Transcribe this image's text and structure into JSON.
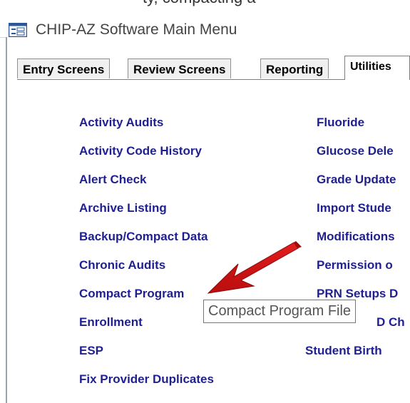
{
  "clipped_top_text": "ty, compacting a",
  "window": {
    "title": "CHIP-AZ Software Main Menu"
  },
  "tabs": [
    {
      "label": "Entry Screens",
      "active": false
    },
    {
      "label": "Review Screens",
      "active": false
    },
    {
      "label": "Reporting",
      "active": false
    },
    {
      "label": "Utilities",
      "active": true
    }
  ],
  "utilities": {
    "left_column": [
      "Activity Audits",
      "Activity Code History",
      "Alert Check",
      "Archive Listing",
      "Backup/Compact Data",
      "Chronic Audits",
      "Compact Program",
      "Enrollment",
      "ESP",
      "Fix Provider Duplicates"
    ],
    "right_column": [
      "Fluoride",
      "Glucose Dele",
      "Grade Update",
      "Import Stude",
      "Modifications",
      "Permission o",
      "PRN Setups D",
      "D Ch",
      "Student Birth"
    ]
  },
  "tooltip": {
    "text": "Compact Program File"
  },
  "colors": {
    "link": "#1f1f8f",
    "arrow": "#cc1111"
  },
  "icons": {
    "app_icon": "form-icon",
    "pointer": "red-arrow"
  }
}
